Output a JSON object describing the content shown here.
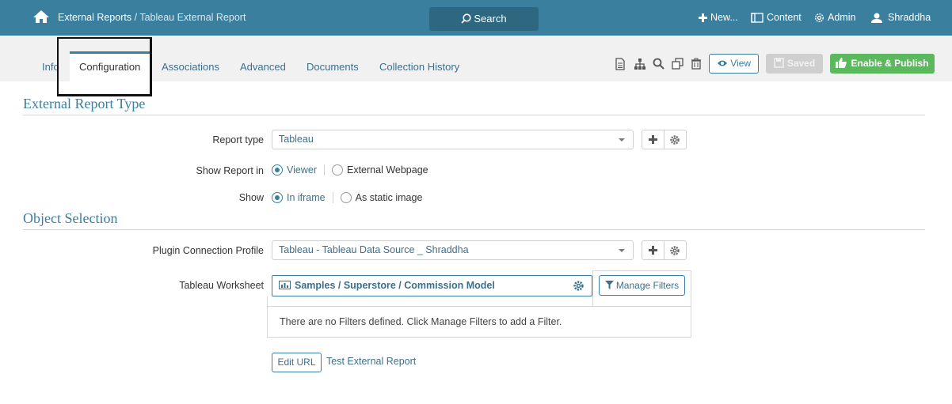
{
  "header": {
    "breadcrumb_parent": "External Reports",
    "breadcrumb_separator": " / ",
    "breadcrumb_current": "Tableau External Report",
    "search_label": "Search",
    "new_label": "New...",
    "content_label": "Content",
    "admin_label": "Admin",
    "user_label": "Shraddha"
  },
  "tabs": [
    {
      "label": "Info"
    },
    {
      "label": "Configuration"
    },
    {
      "label": "Associations"
    },
    {
      "label": "Advanced"
    },
    {
      "label": "Documents"
    },
    {
      "label": "Collection History"
    }
  ],
  "toolbar": {
    "view_label": "View",
    "saved_label": "Saved",
    "publish_label": "Enable & Publish"
  },
  "sections": {
    "report_type_title": "External Report Type",
    "object_selection_title": "Object Selection"
  },
  "form": {
    "report_type_label": "Report type",
    "report_type_value": "Tableau",
    "show_report_in_label": "Show Report in",
    "show_report_in_options": [
      "Viewer",
      "External Webpage"
    ],
    "show_label": "Show",
    "show_options": [
      "In iframe",
      "As static image"
    ],
    "plugin_profile_label": "Plugin Connection Profile",
    "plugin_profile_value": "Tableau - Tableau Data Source _ Shraddha",
    "worksheet_label": "Tableau Worksheet",
    "worksheet_value": "Samples / Superstore / Commission Model",
    "manage_filters_label": "Manage Filters",
    "no_filters_text": "There are no Filters defined. Click Manage Filters to add a Filter.",
    "edit_url_label": "Edit URL",
    "test_link_label": "Test External Report"
  },
  "colors": {
    "topbar": "#3b7f9f",
    "accent": "#3b7f9f",
    "publish": "#5cb85c",
    "saved_disabled": "#cfcfcf"
  }
}
